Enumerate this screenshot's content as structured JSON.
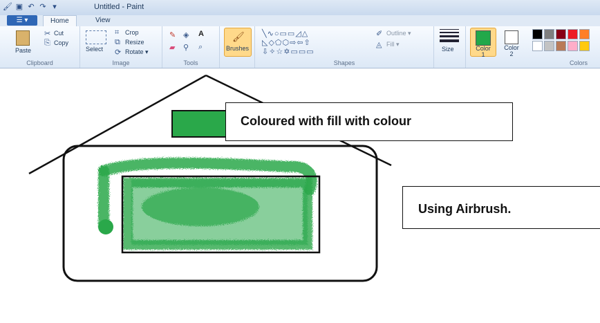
{
  "window": {
    "title": "Untitled - Paint"
  },
  "tabs": {
    "file": "▾",
    "home": "Home",
    "view": "View"
  },
  "clipboard": {
    "paste": "Paste",
    "cut": "Cut",
    "copy": "Copy",
    "label": "Clipboard"
  },
  "image": {
    "select": "Select",
    "crop": "Crop",
    "resize": "Resize",
    "rotate": "Rotate ▾",
    "label": "Image"
  },
  "tools": {
    "label": "Tools"
  },
  "brushes": {
    "label": "Brushes"
  },
  "shapes": {
    "outline": "Outline ▾",
    "fill": "Fill ▾",
    "label": "Shapes"
  },
  "size": {
    "label": "Size"
  },
  "color1": {
    "label": "Color 1",
    "value": "#22a84a"
  },
  "color2": {
    "label": "Color 2",
    "value": "#ffffff"
  },
  "colors": {
    "label": "Colors"
  },
  "palette": [
    "#000000",
    "#7f7f7f",
    "#880015",
    "#ed1c24",
    "#ff7f27",
    "#ffffff",
    "#c3c3c3",
    "#b97a57",
    "#ffaec9",
    "#ffc90e"
  ],
  "annotations": {
    "fill_note": "Coloured with fill with colour",
    "airbrush_note": "Using Airbrush."
  },
  "drawing": {
    "green": "#2aa84a",
    "stroke": "#111111"
  }
}
